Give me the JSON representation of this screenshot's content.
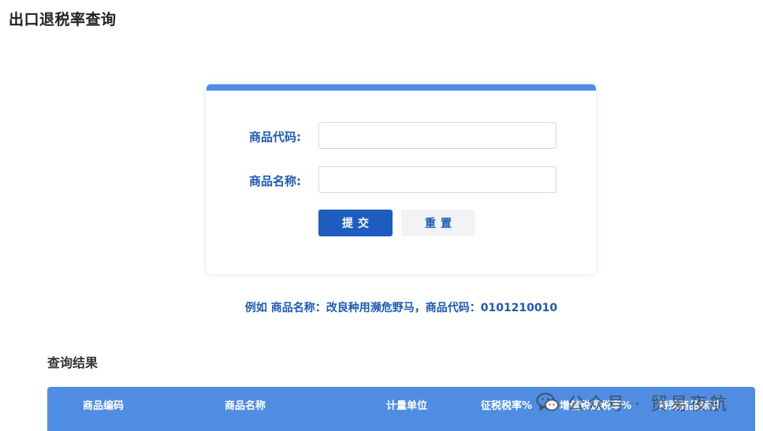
{
  "page": {
    "title": "出口退税率查询"
  },
  "form": {
    "code_label": "商品代码:",
    "code_value": "",
    "name_label": "商品名称:",
    "name_value": "",
    "submit_label": "提交",
    "reset_label": "重置"
  },
  "example": {
    "text": "例如 商品名称：改良种用濒危野马，商品代码：0101210010"
  },
  "results": {
    "heading": "查询结果",
    "columns": [
      "商品编码",
      "商品名称",
      "计量单位",
      "征税税率%",
      "增值税退税率%",
      "特殊商品标识"
    ]
  },
  "watermark": {
    "icon": "wechat-icon",
    "text": "公众号 · 贸易夜航"
  },
  "colors": {
    "accent": "#4f8de3",
    "label": "#1c5ab5",
    "submit": "#1c5dbf"
  }
}
